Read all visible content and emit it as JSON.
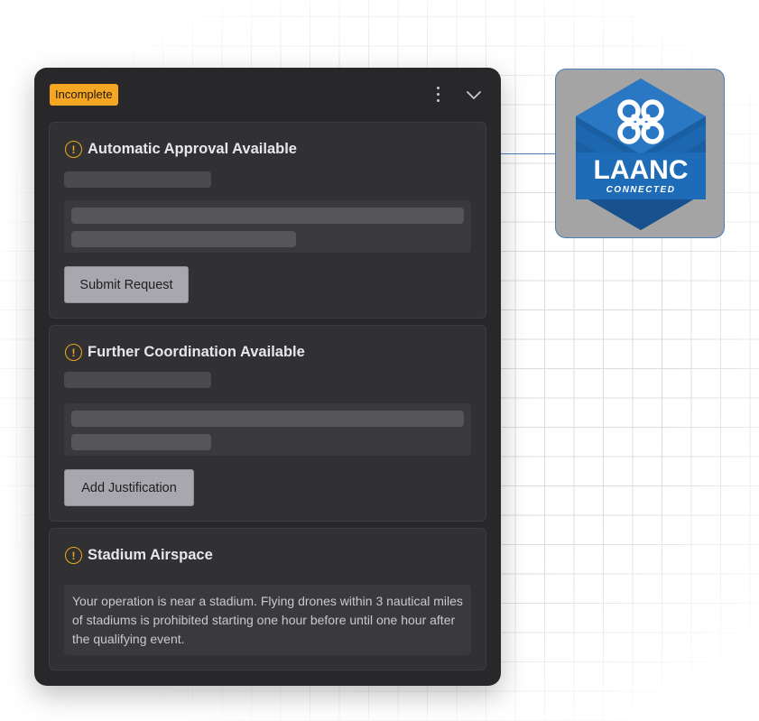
{
  "status_badge": "Incomplete",
  "cards": [
    {
      "title": "Automatic Approval Available",
      "button": "Submit Request"
    },
    {
      "title": "Further Coordination Available",
      "button": "Add Justification"
    },
    {
      "title": "Stadium Airspace",
      "body": "Your operation is near a stadium. Flying drones within 3 nautical miles of stadiums is prohibited starting one hour before until one hour after the qualifying event."
    }
  ],
  "logo": {
    "main_text": "LAANC",
    "sub_text": "CONNECTED"
  },
  "icons": {
    "warning": "!",
    "menu": "kebab-menu-icon",
    "collapse": "chevron-down-icon"
  },
  "colors": {
    "badge": "#f5a623",
    "warning": "#f0a818",
    "panel": "#28282b",
    "logo_blue": "#1b5fa3"
  }
}
